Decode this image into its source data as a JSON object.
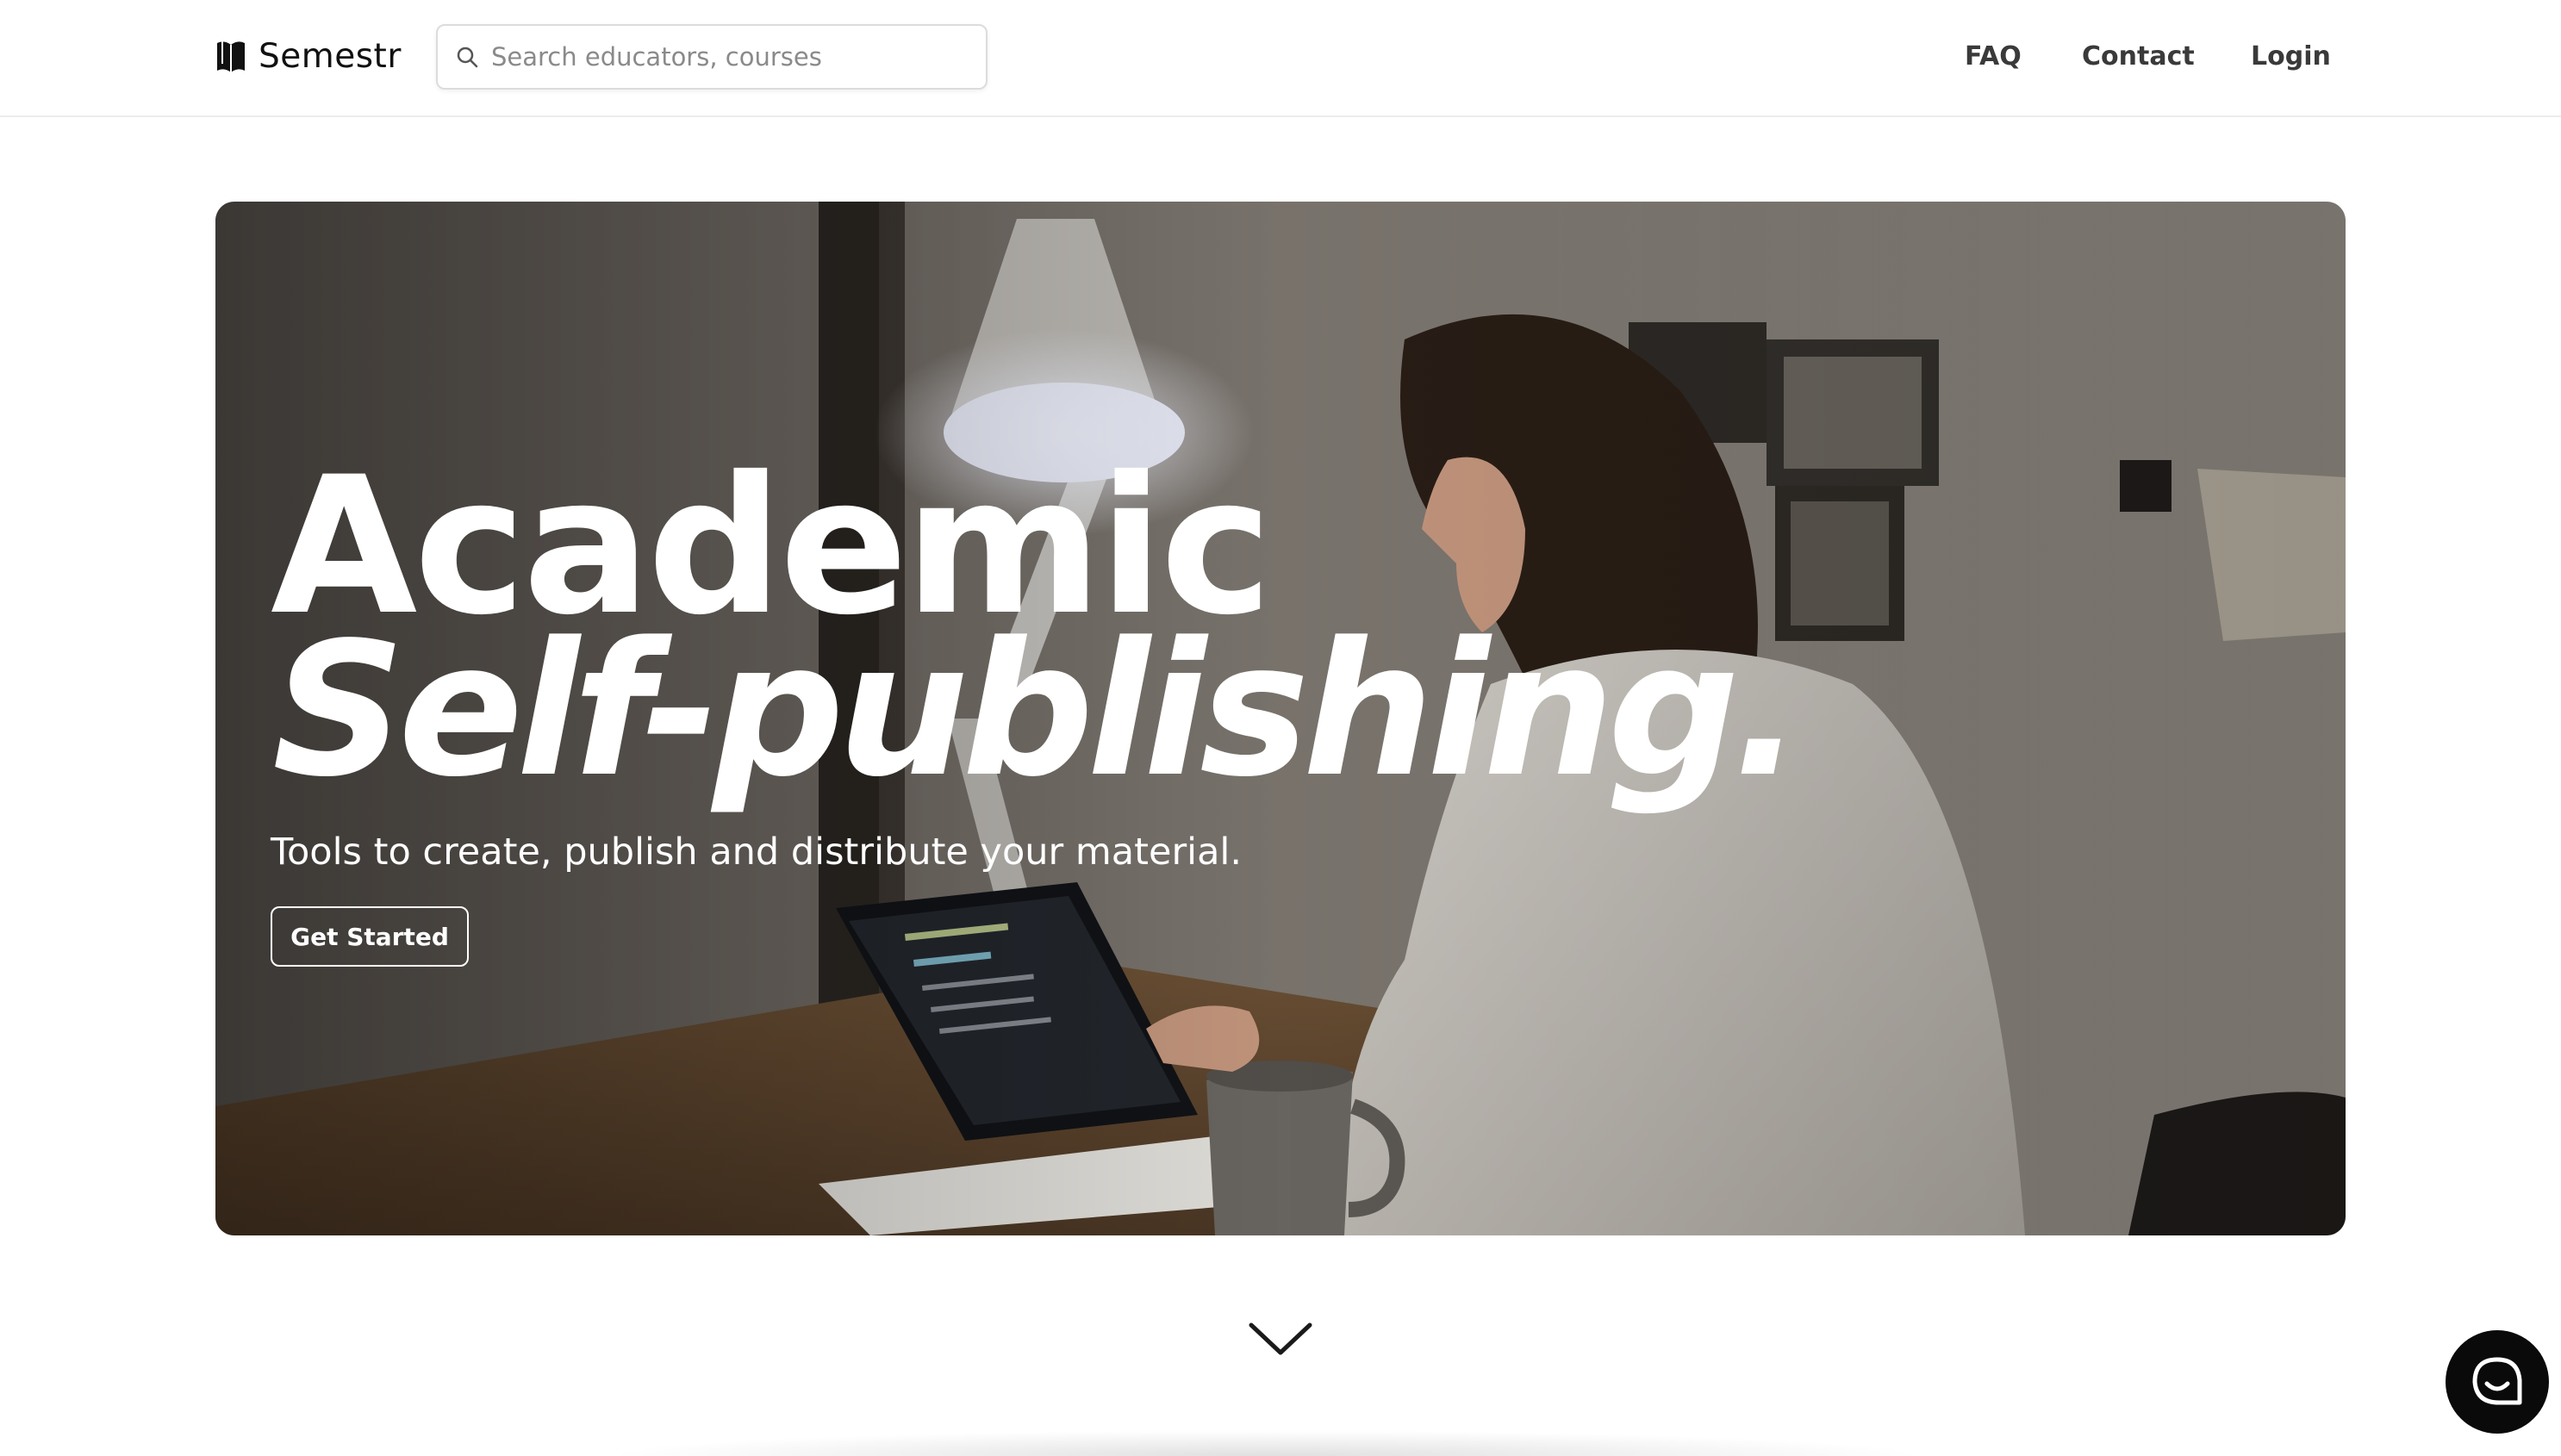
{
  "header": {
    "brand_name": "Semestr",
    "brand_icon": "book-icon",
    "search_placeholder": "Search educators, courses",
    "search_value": "",
    "nav": {
      "faq": "FAQ",
      "contact": "Contact",
      "login": "Login"
    }
  },
  "hero": {
    "title_line1": "Academic",
    "title_line2": "Self-publishing.",
    "subtitle": "Tools to create, publish and distribute your material.",
    "cta_label": "Get Started",
    "background": "photo-woman-reading-tablet-at-desk"
  },
  "icons": {
    "search": "search-icon",
    "scroll_down": "chevron-down-icon",
    "chat": "chat-icon"
  },
  "colors": {
    "text_dark": "#1a1a1a",
    "nav_text": "#3a3a3a",
    "hero_text": "#ffffff",
    "chat_bg": "#0a0a0a",
    "header_border": "#ececec"
  }
}
